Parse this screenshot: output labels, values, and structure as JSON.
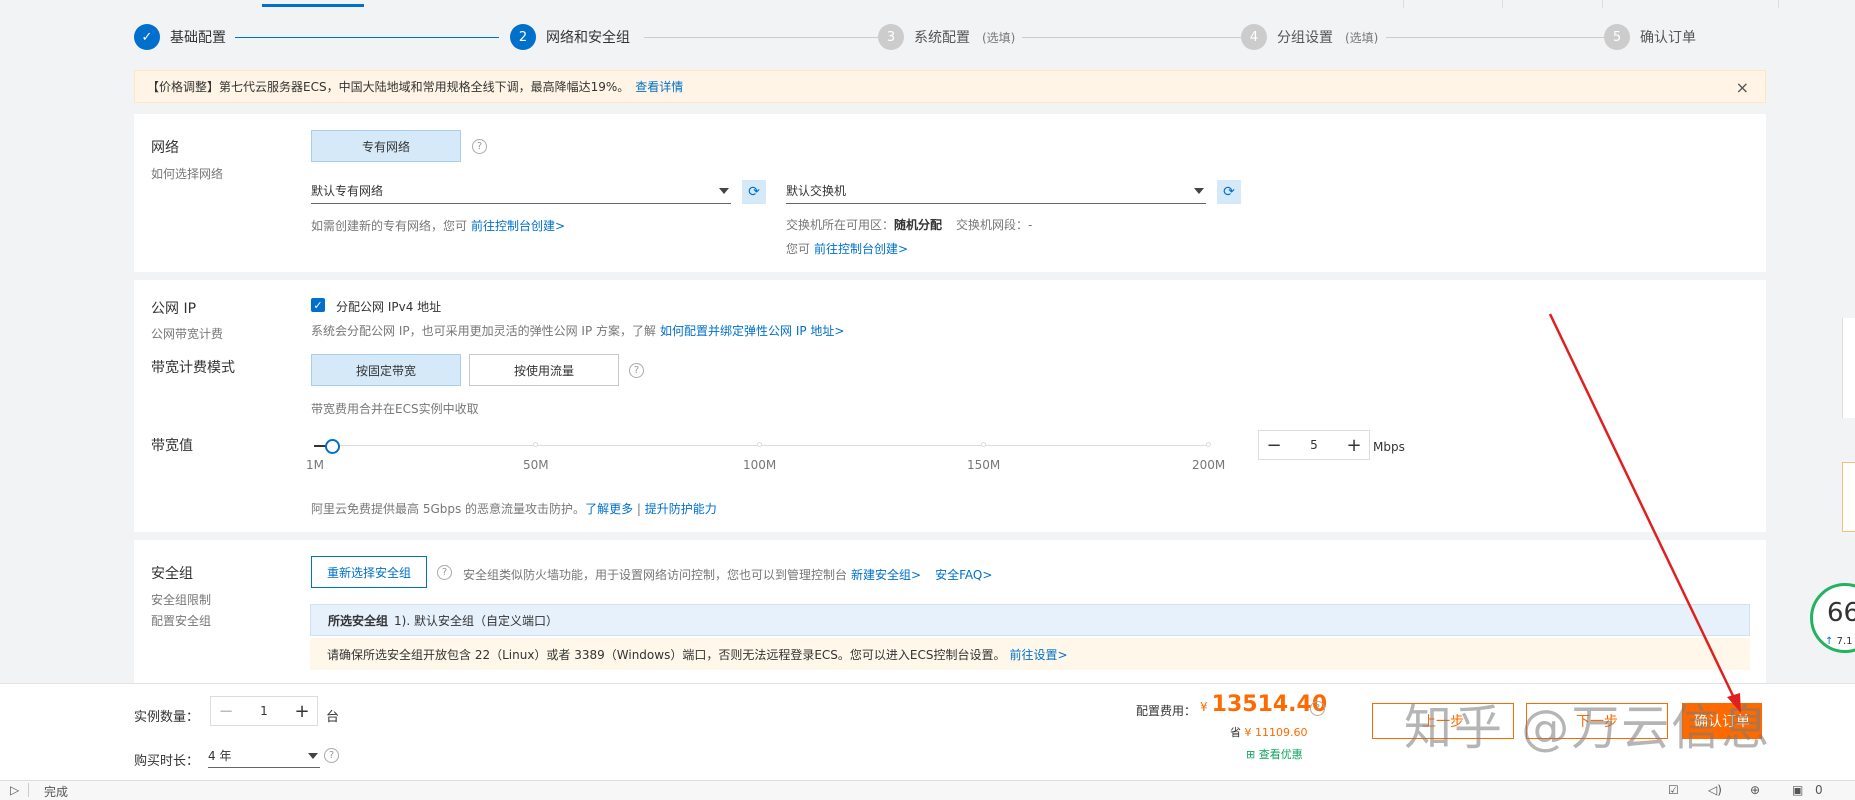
{
  "steps": [
    {
      "num": "✓",
      "label": "基础配置",
      "optional": ""
    },
    {
      "num": "2",
      "label": "网络和安全组",
      "optional": ""
    },
    {
      "num": "3",
      "label": "系统配置",
      "optional": "(选填)"
    },
    {
      "num": "4",
      "label": "分组设置",
      "optional": "(选填)"
    },
    {
      "num": "5",
      "label": "确认订单",
      "optional": ""
    }
  ],
  "notice": {
    "text": "【价格调整】第七代云服务器ECS，中国大陆地域和常用规格全线下调，最高降幅达19%。",
    "link": "查看详情",
    "close": "×"
  },
  "network": {
    "title": "网络",
    "subtitle": "如何选择网络",
    "type_button": "专有网络",
    "help": "?",
    "vpc_select": "默认专有网络",
    "vpc_hint": "如需创建新的专有网络，您可",
    "vpc_hint_link": "前往控制台创建>",
    "vswitch_select": "默认交换机",
    "zone_label": "交换机所在可用区：",
    "zone_value": "随机分配",
    "cidr_label": "交换机网段：",
    "cidr_value": "-",
    "vswitch_hint": "您可",
    "vswitch_hint_link": "前往控制台创建>",
    "refresh_icon": "⟳"
  },
  "public_ip": {
    "title": "公网 IP",
    "subtitle": "公网带宽计费",
    "checkbox_label": "分配公网 IPv4 地址",
    "checkbox_mark": "✓",
    "desc": "系统会分配公网 IP，也可采用更加灵活的弹性公网 IP 方案，了解",
    "desc_link": "如何配置并绑定弹性公网 IP 地址>",
    "billing_title": "带宽计费模式",
    "billing_fixed": "按固定带宽",
    "billing_traffic": "按使用流量",
    "billing_help": "?",
    "billing_note": "带宽费用合并在ECS实例中收取",
    "bandwidth_title": "带宽值",
    "slider_labels": [
      "1M",
      "50M",
      "100M",
      "150M",
      "200M"
    ],
    "slider_value_fraction": 0.02,
    "stepper_minus": "−",
    "stepper_value": "5",
    "stepper_plus": "+",
    "unit": "Mbps",
    "ddos_note": "阿里云免费提供最高 5Gbps 的恶意流量攻击防护。",
    "ddos_link1": "了解更多",
    "ddos_sep": "|",
    "ddos_link2": "提升防护能力"
  },
  "security_group": {
    "title": "安全组",
    "sub1": "安全组限制",
    "sub2": "配置安全组",
    "reselect_button": "重新选择安全组",
    "help": "?",
    "desc": "安全组类似防火墙功能，用于设置网络访问控制，您也可以到管理控制台",
    "desc_link1": "新建安全组>",
    "desc_link2": "安全FAQ>",
    "selected_label": "所选安全组",
    "selected_value": "1). 默认安全组（自定义端口）",
    "warning": "请确保所选安全组开放包含 22（Linux）或者 3389（Windows）端口，否则无法远程登录ECS。您可以进入ECS控制台设置。",
    "warning_link": "前往设置>"
  },
  "footer": {
    "qty_label": "实例数量：",
    "qty_minus": "−",
    "qty_value": "1",
    "qty_plus": "+",
    "qty_unit": "台",
    "duration_label": "购买时长：",
    "duration_value": "4 年",
    "duration_help": "?",
    "price_label": "配置费用：",
    "price_currency": "¥",
    "price_value": "13514.40",
    "price_help": "?",
    "save_prefix": "省",
    "save_value": "¥ 11109.60",
    "discount_link": "查看优惠",
    "btn_prev": "上一步",
    "btn_next": "下一步",
    "btn_confirm": "确认订单",
    "watermark": "知乎 @万云信息"
  },
  "status_bar": {
    "text": "完成",
    "zoom": "0"
  },
  "gauge": {
    "value": "66",
    "sub_value": "7.1"
  },
  "colors": {
    "accent": "#0070cc",
    "orange": "#ff6a00",
    "selected_bg": "#d6e9f8",
    "notice_bg": "#fff4e5"
  }
}
